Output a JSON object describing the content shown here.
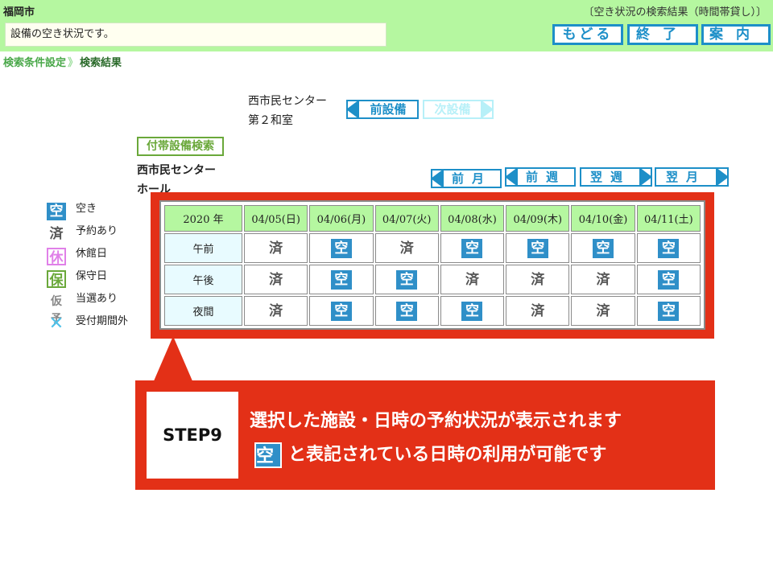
{
  "header": {
    "city": "福岡市",
    "subtitle": "〔空き状況の検索結果（時間帯貸し）〕",
    "message": "設備の空き状況です。",
    "buttons": {
      "back": "もどる",
      "end": "終了",
      "guide": "案内"
    }
  },
  "breadcrumb": {
    "step1": "検索条件設定",
    "separator": "》",
    "step2": "検索結果"
  },
  "facility": {
    "name_line1": "西市民センター",
    "name_line2": "第２和室",
    "prev_label": "前設備",
    "next_label": "次設備"
  },
  "aux_search_label": "付帯設備検索",
  "hall": {
    "line1": "西市民センター",
    "line2": "ホール"
  },
  "date_nav": {
    "prev_month": "前月",
    "prev_week": "前週",
    "next_week": "翌週",
    "next_month": "翌月"
  },
  "legend": [
    {
      "icon": "空",
      "label": "空き"
    },
    {
      "icon": "済",
      "label": "予約あり"
    },
    {
      "icon": "休",
      "label": "休館日"
    },
    {
      "icon": "保",
      "label": "保守日"
    },
    {
      "icon": "仮予",
      "label": "当選あり"
    },
    {
      "icon": "✕",
      "label": "受付期間外"
    }
  ],
  "grid": {
    "year_label": "2020 年",
    "dates": [
      "04/05(日)",
      "04/06(月)",
      "04/07(火)",
      "04/08(水)",
      "04/09(木)",
      "04/10(金)",
      "04/11(土)"
    ],
    "rows": [
      {
        "period": "午前",
        "cells": [
          "済",
          "空",
          "済",
          "空",
          "空",
          "空",
          "空"
        ]
      },
      {
        "period": "午後",
        "cells": [
          "済",
          "空",
          "空",
          "済",
          "済",
          "済",
          "空"
        ]
      },
      {
        "period": "夜間",
        "cells": [
          "済",
          "空",
          "空",
          "空",
          "済",
          "済",
          "空"
        ]
      }
    ]
  },
  "callout": {
    "step": "STEP9",
    "line1": "選択した施設・日時の予約状況が表示されます",
    "line2_icon": "空",
    "line2": "と表記されている日時の利用が可能です"
  },
  "colors": {
    "header_green": "#b5f7a0",
    "accent_blue": "#1d8fc8",
    "callout_red": "#e33017"
  }
}
